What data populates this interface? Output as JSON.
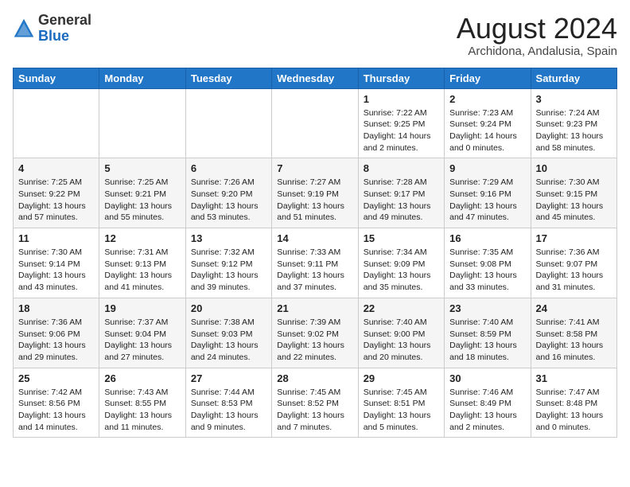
{
  "header": {
    "logo_line1": "General",
    "logo_line2": "Blue",
    "main_title": "August 2024",
    "subtitle": "Archidona, Andalusia, Spain"
  },
  "days_of_week": [
    "Sunday",
    "Monday",
    "Tuesday",
    "Wednesday",
    "Thursday",
    "Friday",
    "Saturday"
  ],
  "weeks": [
    [
      {
        "day": "",
        "content": ""
      },
      {
        "day": "",
        "content": ""
      },
      {
        "day": "",
        "content": ""
      },
      {
        "day": "",
        "content": ""
      },
      {
        "day": "1",
        "content": "Sunrise: 7:22 AM\nSunset: 9:25 PM\nDaylight: 14 hours\nand 2 minutes."
      },
      {
        "day": "2",
        "content": "Sunrise: 7:23 AM\nSunset: 9:24 PM\nDaylight: 14 hours\nand 0 minutes."
      },
      {
        "day": "3",
        "content": "Sunrise: 7:24 AM\nSunset: 9:23 PM\nDaylight: 13 hours\nand 58 minutes."
      }
    ],
    [
      {
        "day": "4",
        "content": "Sunrise: 7:25 AM\nSunset: 9:22 PM\nDaylight: 13 hours\nand 57 minutes."
      },
      {
        "day": "5",
        "content": "Sunrise: 7:25 AM\nSunset: 9:21 PM\nDaylight: 13 hours\nand 55 minutes."
      },
      {
        "day": "6",
        "content": "Sunrise: 7:26 AM\nSunset: 9:20 PM\nDaylight: 13 hours\nand 53 minutes."
      },
      {
        "day": "7",
        "content": "Sunrise: 7:27 AM\nSunset: 9:19 PM\nDaylight: 13 hours\nand 51 minutes."
      },
      {
        "day": "8",
        "content": "Sunrise: 7:28 AM\nSunset: 9:17 PM\nDaylight: 13 hours\nand 49 minutes."
      },
      {
        "day": "9",
        "content": "Sunrise: 7:29 AM\nSunset: 9:16 PM\nDaylight: 13 hours\nand 47 minutes."
      },
      {
        "day": "10",
        "content": "Sunrise: 7:30 AM\nSunset: 9:15 PM\nDaylight: 13 hours\nand 45 minutes."
      }
    ],
    [
      {
        "day": "11",
        "content": "Sunrise: 7:30 AM\nSunset: 9:14 PM\nDaylight: 13 hours\nand 43 minutes."
      },
      {
        "day": "12",
        "content": "Sunrise: 7:31 AM\nSunset: 9:13 PM\nDaylight: 13 hours\nand 41 minutes."
      },
      {
        "day": "13",
        "content": "Sunrise: 7:32 AM\nSunset: 9:12 PM\nDaylight: 13 hours\nand 39 minutes."
      },
      {
        "day": "14",
        "content": "Sunrise: 7:33 AM\nSunset: 9:11 PM\nDaylight: 13 hours\nand 37 minutes."
      },
      {
        "day": "15",
        "content": "Sunrise: 7:34 AM\nSunset: 9:09 PM\nDaylight: 13 hours\nand 35 minutes."
      },
      {
        "day": "16",
        "content": "Sunrise: 7:35 AM\nSunset: 9:08 PM\nDaylight: 13 hours\nand 33 minutes."
      },
      {
        "day": "17",
        "content": "Sunrise: 7:36 AM\nSunset: 9:07 PM\nDaylight: 13 hours\nand 31 minutes."
      }
    ],
    [
      {
        "day": "18",
        "content": "Sunrise: 7:36 AM\nSunset: 9:06 PM\nDaylight: 13 hours\nand 29 minutes."
      },
      {
        "day": "19",
        "content": "Sunrise: 7:37 AM\nSunset: 9:04 PM\nDaylight: 13 hours\nand 27 minutes."
      },
      {
        "day": "20",
        "content": "Sunrise: 7:38 AM\nSunset: 9:03 PM\nDaylight: 13 hours\nand 24 minutes."
      },
      {
        "day": "21",
        "content": "Sunrise: 7:39 AM\nSunset: 9:02 PM\nDaylight: 13 hours\nand 22 minutes."
      },
      {
        "day": "22",
        "content": "Sunrise: 7:40 AM\nSunset: 9:00 PM\nDaylight: 13 hours\nand 20 minutes."
      },
      {
        "day": "23",
        "content": "Sunrise: 7:40 AM\nSunset: 8:59 PM\nDaylight: 13 hours\nand 18 minutes."
      },
      {
        "day": "24",
        "content": "Sunrise: 7:41 AM\nSunset: 8:58 PM\nDaylight: 13 hours\nand 16 minutes."
      }
    ],
    [
      {
        "day": "25",
        "content": "Sunrise: 7:42 AM\nSunset: 8:56 PM\nDaylight: 13 hours\nand 14 minutes."
      },
      {
        "day": "26",
        "content": "Sunrise: 7:43 AM\nSunset: 8:55 PM\nDaylight: 13 hours\nand 11 minutes."
      },
      {
        "day": "27",
        "content": "Sunrise: 7:44 AM\nSunset: 8:53 PM\nDaylight: 13 hours\nand 9 minutes."
      },
      {
        "day": "28",
        "content": "Sunrise: 7:45 AM\nSunset: 8:52 PM\nDaylight: 13 hours\nand 7 minutes."
      },
      {
        "day": "29",
        "content": "Sunrise: 7:45 AM\nSunset: 8:51 PM\nDaylight: 13 hours\nand 5 minutes."
      },
      {
        "day": "30",
        "content": "Sunrise: 7:46 AM\nSunset: 8:49 PM\nDaylight: 13 hours\nand 2 minutes."
      },
      {
        "day": "31",
        "content": "Sunrise: 7:47 AM\nSunset: 8:48 PM\nDaylight: 13 hours\nand 0 minutes."
      }
    ]
  ]
}
